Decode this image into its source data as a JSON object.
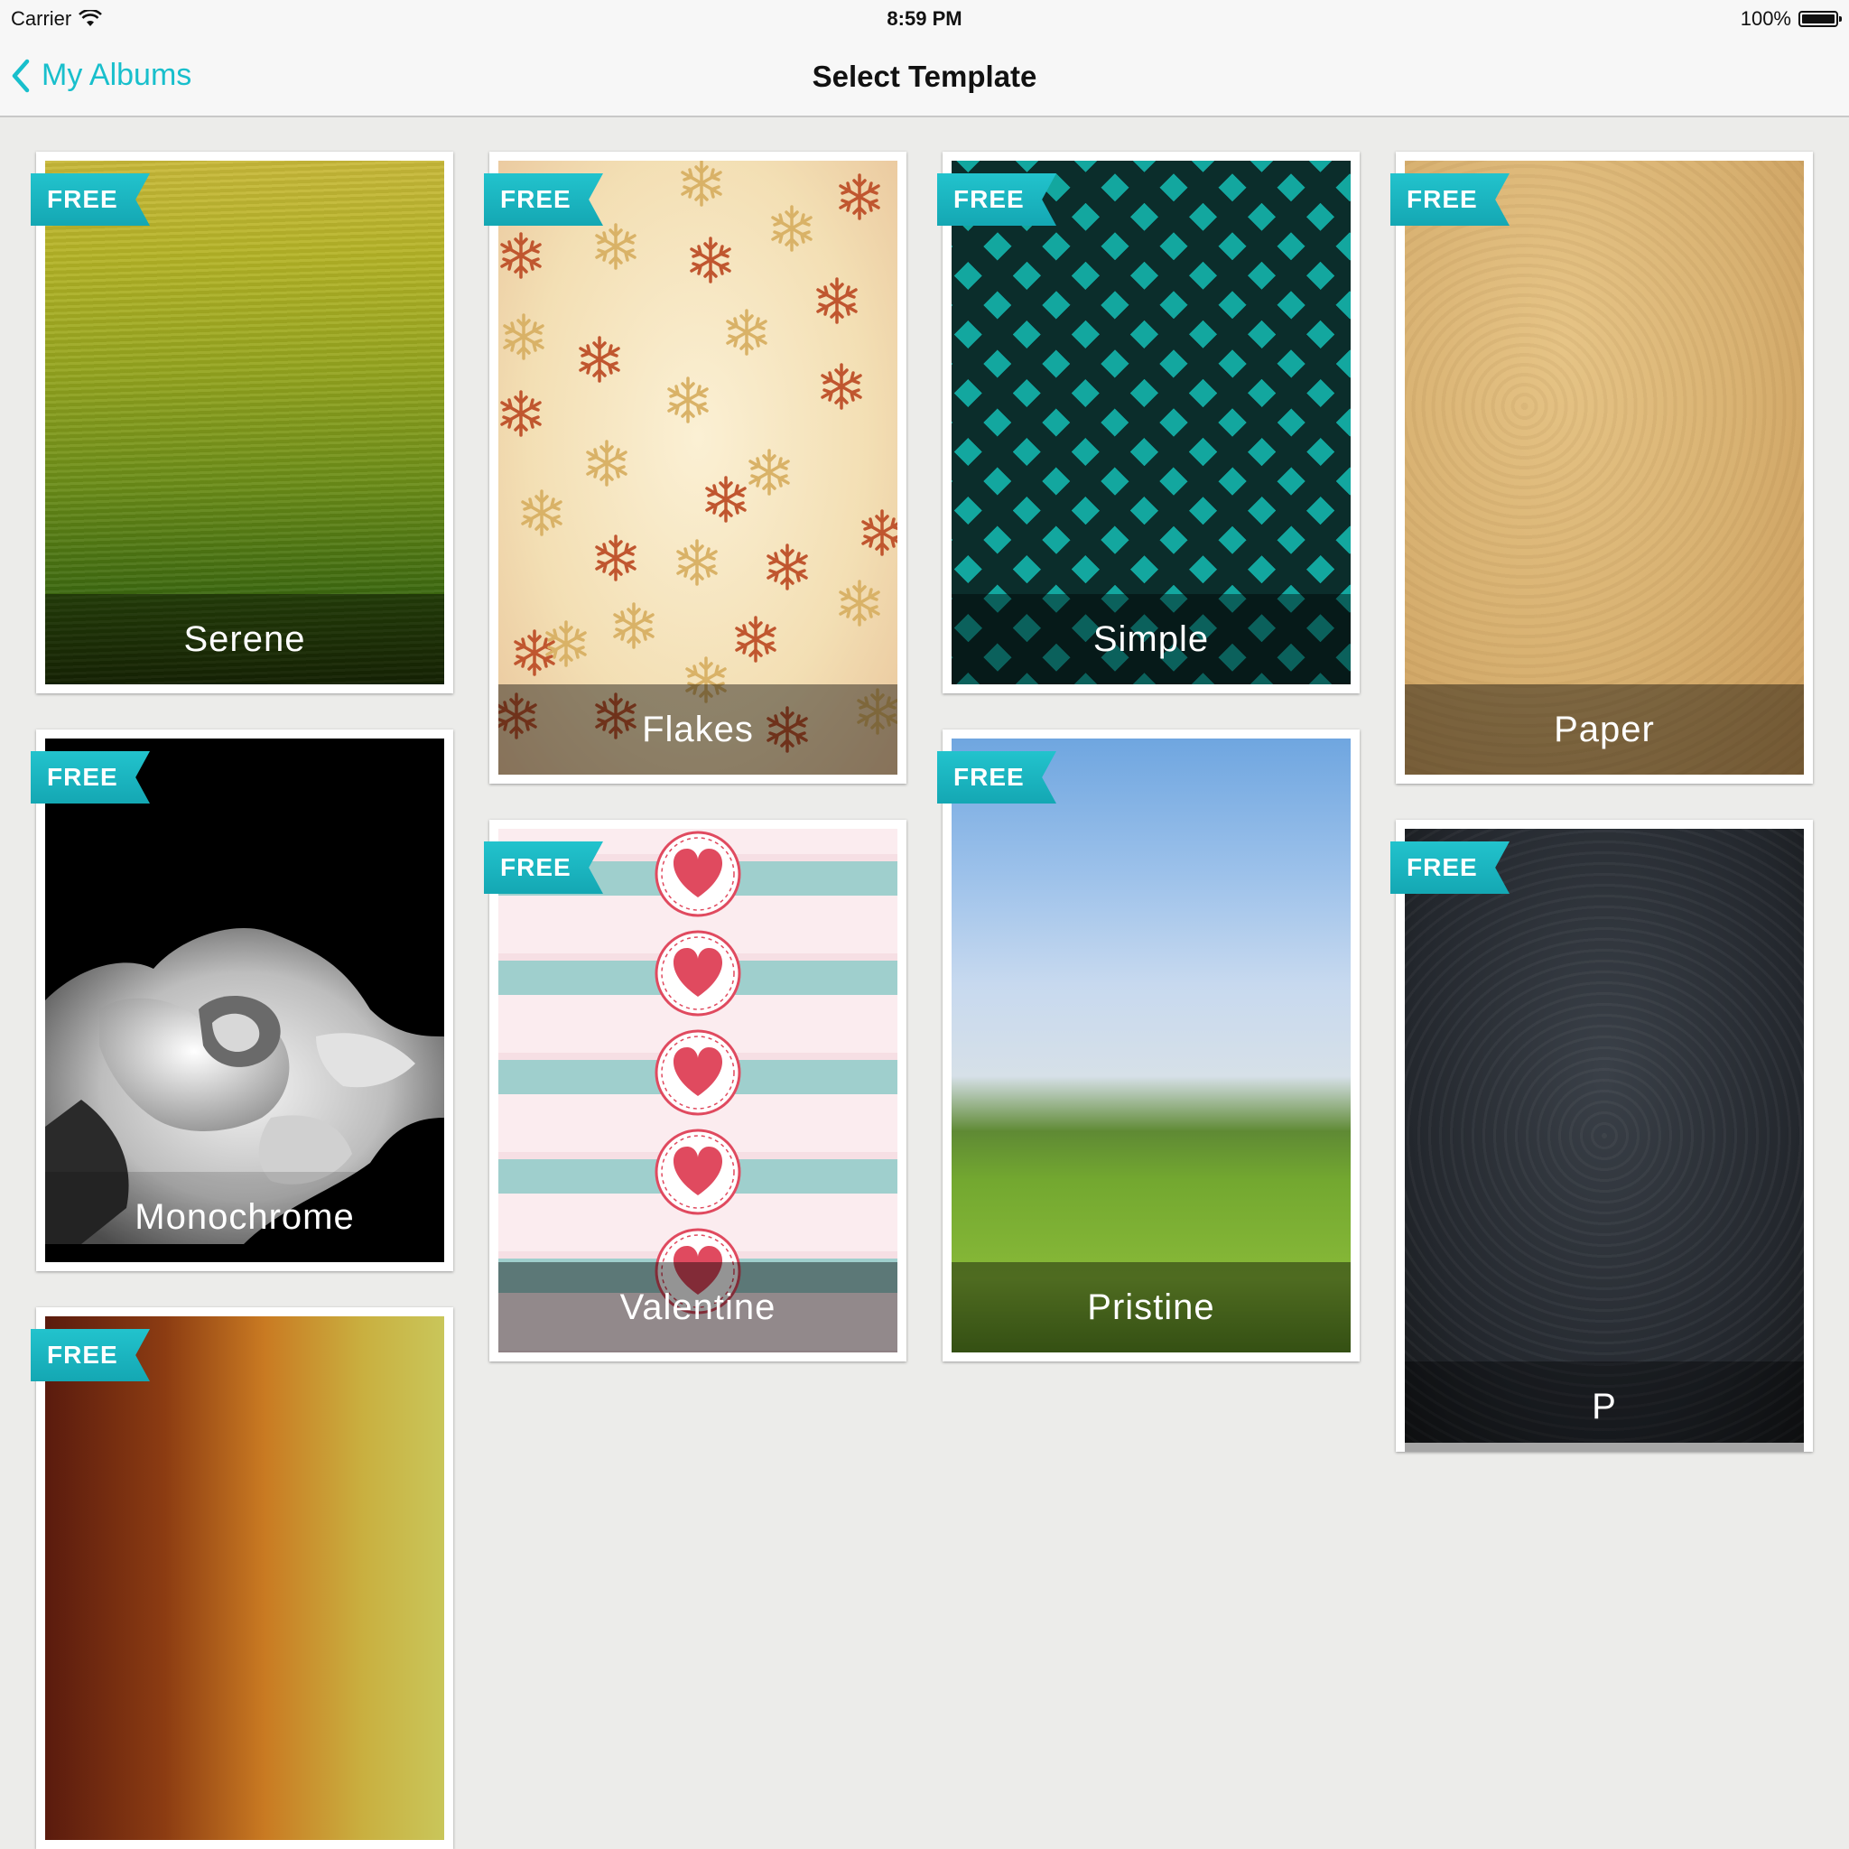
{
  "status_bar": {
    "carrier": "Carrier",
    "time": "8:59 PM",
    "battery": "100%"
  },
  "nav": {
    "back_label": "My Albums",
    "title": "Select Template"
  },
  "badge_text": "FREE",
  "templates": [
    {
      "name": "Serene"
    },
    {
      "name": "Flakes"
    },
    {
      "name": "Simple"
    },
    {
      "name": "Paper"
    },
    {
      "name": "Monochrome"
    },
    {
      "name": "Valentine"
    },
    {
      "name": "Pristine"
    },
    {
      "name": "P"
    },
    {
      "name": ""
    }
  ],
  "colors": {
    "accent": "#18bfcc",
    "badge": "#1ab5c0",
    "background": "#ececea"
  }
}
